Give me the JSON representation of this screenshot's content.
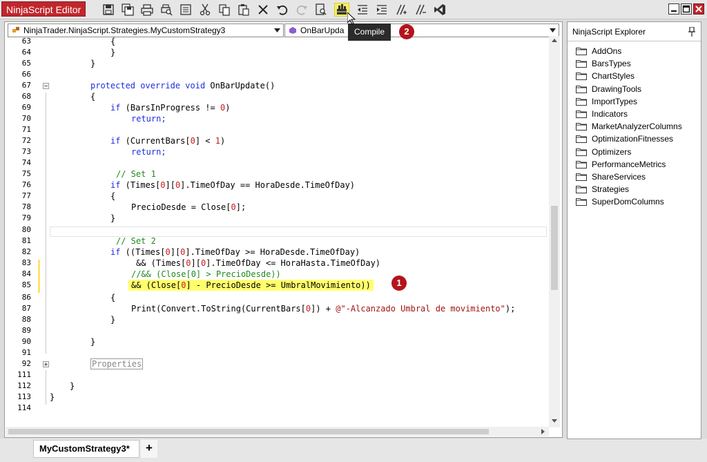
{
  "app": {
    "title": "NinjaScript Editor"
  },
  "toolbar": {
    "icons": [
      "save-icon",
      "save-all-icon",
      "print-icon",
      "print-preview-icon",
      "properties-icon",
      "cut-icon",
      "copy-icon",
      "paste-icon",
      "delete-icon",
      "undo-icon",
      "redo-icon",
      "find-icon",
      "compile-icon",
      "outdent-icon",
      "indent-icon",
      "comment-icon",
      "uncomment-icon",
      "visual-studio-icon"
    ],
    "tooltip": "Compile"
  },
  "editor": {
    "type_combo": "NinjaTrader.NinjaScript.Strategies.MyCustomStrategy3",
    "member_combo": "OnBarUpda",
    "line_numbers": [
      "63",
      "64",
      "65",
      "66",
      "67",
      "68",
      "69",
      "70",
      "71",
      "72",
      "73",
      "74",
      "75",
      "76",
      "77",
      "78",
      "79",
      "80",
      "81",
      "82",
      "83",
      "84",
      "85",
      "86",
      "87",
      "88",
      "89",
      "90",
      "91",
      "92",
      "111",
      "112",
      "113",
      "114"
    ],
    "code": {
      "l63": "{",
      "l64": "}",
      "l65": "}",
      "l67a": "protected override void",
      "l67b": " OnBarUpdate()",
      "l68": "{",
      "l69a": "if",
      "l69b": " (BarsInProgress != ",
      "l69c": "0",
      "l69d": ")",
      "l70": "return;",
      "l72a": "if",
      "l72b": " (CurrentBars[",
      "l72c": "0",
      "l72d": "] < ",
      "l72e": "1",
      "l72f": ")",
      "l73": "return;",
      "l75": "// Set 1",
      "l76a": "if",
      "l76b": " (Times[",
      "l76c": "0",
      "l76d": "][",
      "l76e": "0",
      "l76f": "].TimeOfDay == HoraDesde.TimeOfDay)",
      "l77": "{",
      "l78a": "PrecioDesde = Close[",
      "l78b": "0",
      "l78c": "];",
      "l79": "}",
      "l81": "// Set 2",
      "l82a": "if",
      "l82b": " ((Times[",
      "l82c": "0",
      "l82d": "][",
      "l82e": "0",
      "l82f": "].TimeOfDay >= HoraDesde.TimeOfDay)",
      "l83a": "&& (Times[",
      "l83b": "0",
      "l83c": "][",
      "l83d": "0",
      "l83e": "].TimeOfDay <= HoraHasta.TimeOfDay)",
      "l84": "//&& (Close[0] > PrecioDesde))",
      "l85a": "&& (Close[",
      "l85b": "0",
      "l85c": "] - PrecioDesde >= UmbralMovimiento))",
      "l86": "{",
      "l87a": "Print(Convert.ToString(CurrentBars[",
      "l87b": "0",
      "l87c": "]) + ",
      "l87d": "@\"-Alcanzado Umbral de movimiento\"",
      "l87e": ");",
      "l88": "}",
      "l90": "}",
      "l92": "Properties",
      "l112": "}",
      "l113": "}"
    }
  },
  "markers": {
    "m1": "1",
    "m2": "2"
  },
  "tabs": {
    "active": "MyCustomStrategy3*",
    "add": "+"
  },
  "explorer": {
    "title": "NinjaScript Explorer",
    "folders": [
      "AddOns",
      "BarsTypes",
      "ChartStyles",
      "DrawingTools",
      "ImportTypes",
      "Indicators",
      "MarketAnalyzerColumns",
      "OptimizationFitnesses",
      "Optimizers",
      "PerformanceMetrics",
      "ShareServices",
      "Strategies",
      "SuperDomColumns"
    ]
  },
  "colors": {
    "title_bg": "#c0272d",
    "highlight": "#ffff6e",
    "keyword": "#1f2ee0",
    "number": "#c41a16",
    "comment": "#1f8a1f",
    "marker": "#b3141c"
  }
}
